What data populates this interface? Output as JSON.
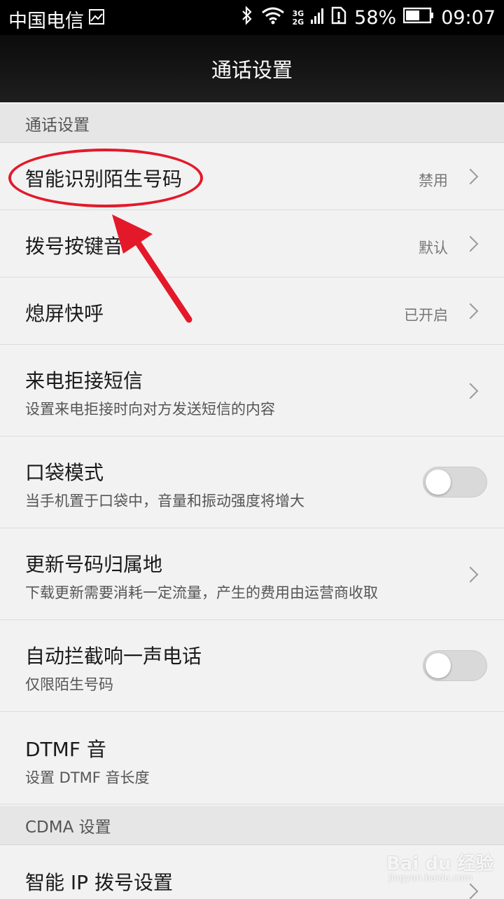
{
  "status_bar": {
    "carrier": "中国电信",
    "network_top": "3G",
    "network_bottom": "2G",
    "battery": "58%",
    "time": "09:07"
  },
  "title": "通话设置",
  "sections": [
    {
      "header": "通话设置"
    },
    {
      "header": "CDMA 设置"
    }
  ],
  "items": [
    {
      "title": "智能识别陌生号码",
      "value": "禁用",
      "control": "chevron"
    },
    {
      "title": "拨号按键音",
      "value": "默认",
      "control": "chevron"
    },
    {
      "title": "熄屏快呼",
      "value": "已开启",
      "control": "chevron"
    },
    {
      "title": "来电拒接短信",
      "subtitle": "设置来电拒接时向对方发送短信的内容",
      "control": "chevron"
    },
    {
      "title": "口袋模式",
      "subtitle": "当手机置于口袋中，音量和振动强度将增大",
      "control": "toggle",
      "toggle_on": false
    },
    {
      "title": "更新号码归属地",
      "subtitle": "下载更新需要消耗一定流量，产生的费用由运营商收取",
      "control": "chevron"
    },
    {
      "title": "自动拦截响一声电话",
      "subtitle": "仅限陌生号码",
      "control": "toggle",
      "toggle_on": false
    },
    {
      "title": "DTMF 音",
      "subtitle": "设置 DTMF 音长度",
      "control": "none"
    },
    {
      "title": "智能 IP 拨号设置",
      "control": "chevron"
    }
  ],
  "watermark": {
    "brand": "Bai du 经验",
    "url": "jingyan.baidu.com"
  },
  "colors": {
    "annotation_red": "#e3192a",
    "background": "#f2f2f2"
  }
}
